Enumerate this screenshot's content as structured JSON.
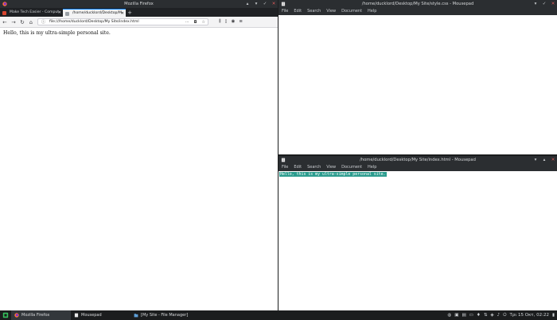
{
  "firefox": {
    "window_title": "Mozilla Firefox",
    "tabs": [
      {
        "label": "Make Tech Easier - Comput"
      },
      {
        "label": "/home/ducklord/Desktop/M"
      }
    ],
    "new_tab": "+",
    "url": "file:///home/ducklord/Desktop/My Site/index.html",
    "url_more": "···",
    "page_text": "Hello, this is my ultra-simple personal site."
  },
  "mousepad_top": {
    "title": "/home/ducklord/Desktop/My Site/style.css - Mousepad",
    "menu": [
      "File",
      "Edit",
      "Search",
      "View",
      "Document",
      "Help"
    ]
  },
  "mousepad_bottom": {
    "title": "/home/ducklord/Desktop/My Site/index.html - Mousepad",
    "menu": [
      "File",
      "Edit",
      "Search",
      "View",
      "Document",
      "Help"
    ],
    "selected_text": "Hello, this is my ultra-simple personal site."
  },
  "taskbar": {
    "items": [
      {
        "label": "Mozilla Firefox"
      },
      {
        "label": "Mousepad"
      },
      {
        "label": "[My Site - File Manager]"
      }
    ],
    "clock": "Τρι 15 Οκτ, 02:22"
  },
  "colors": {
    "selection": "#2c9c8e",
    "close": "#e05a5a",
    "firefox_accent": "#0a84ff"
  }
}
